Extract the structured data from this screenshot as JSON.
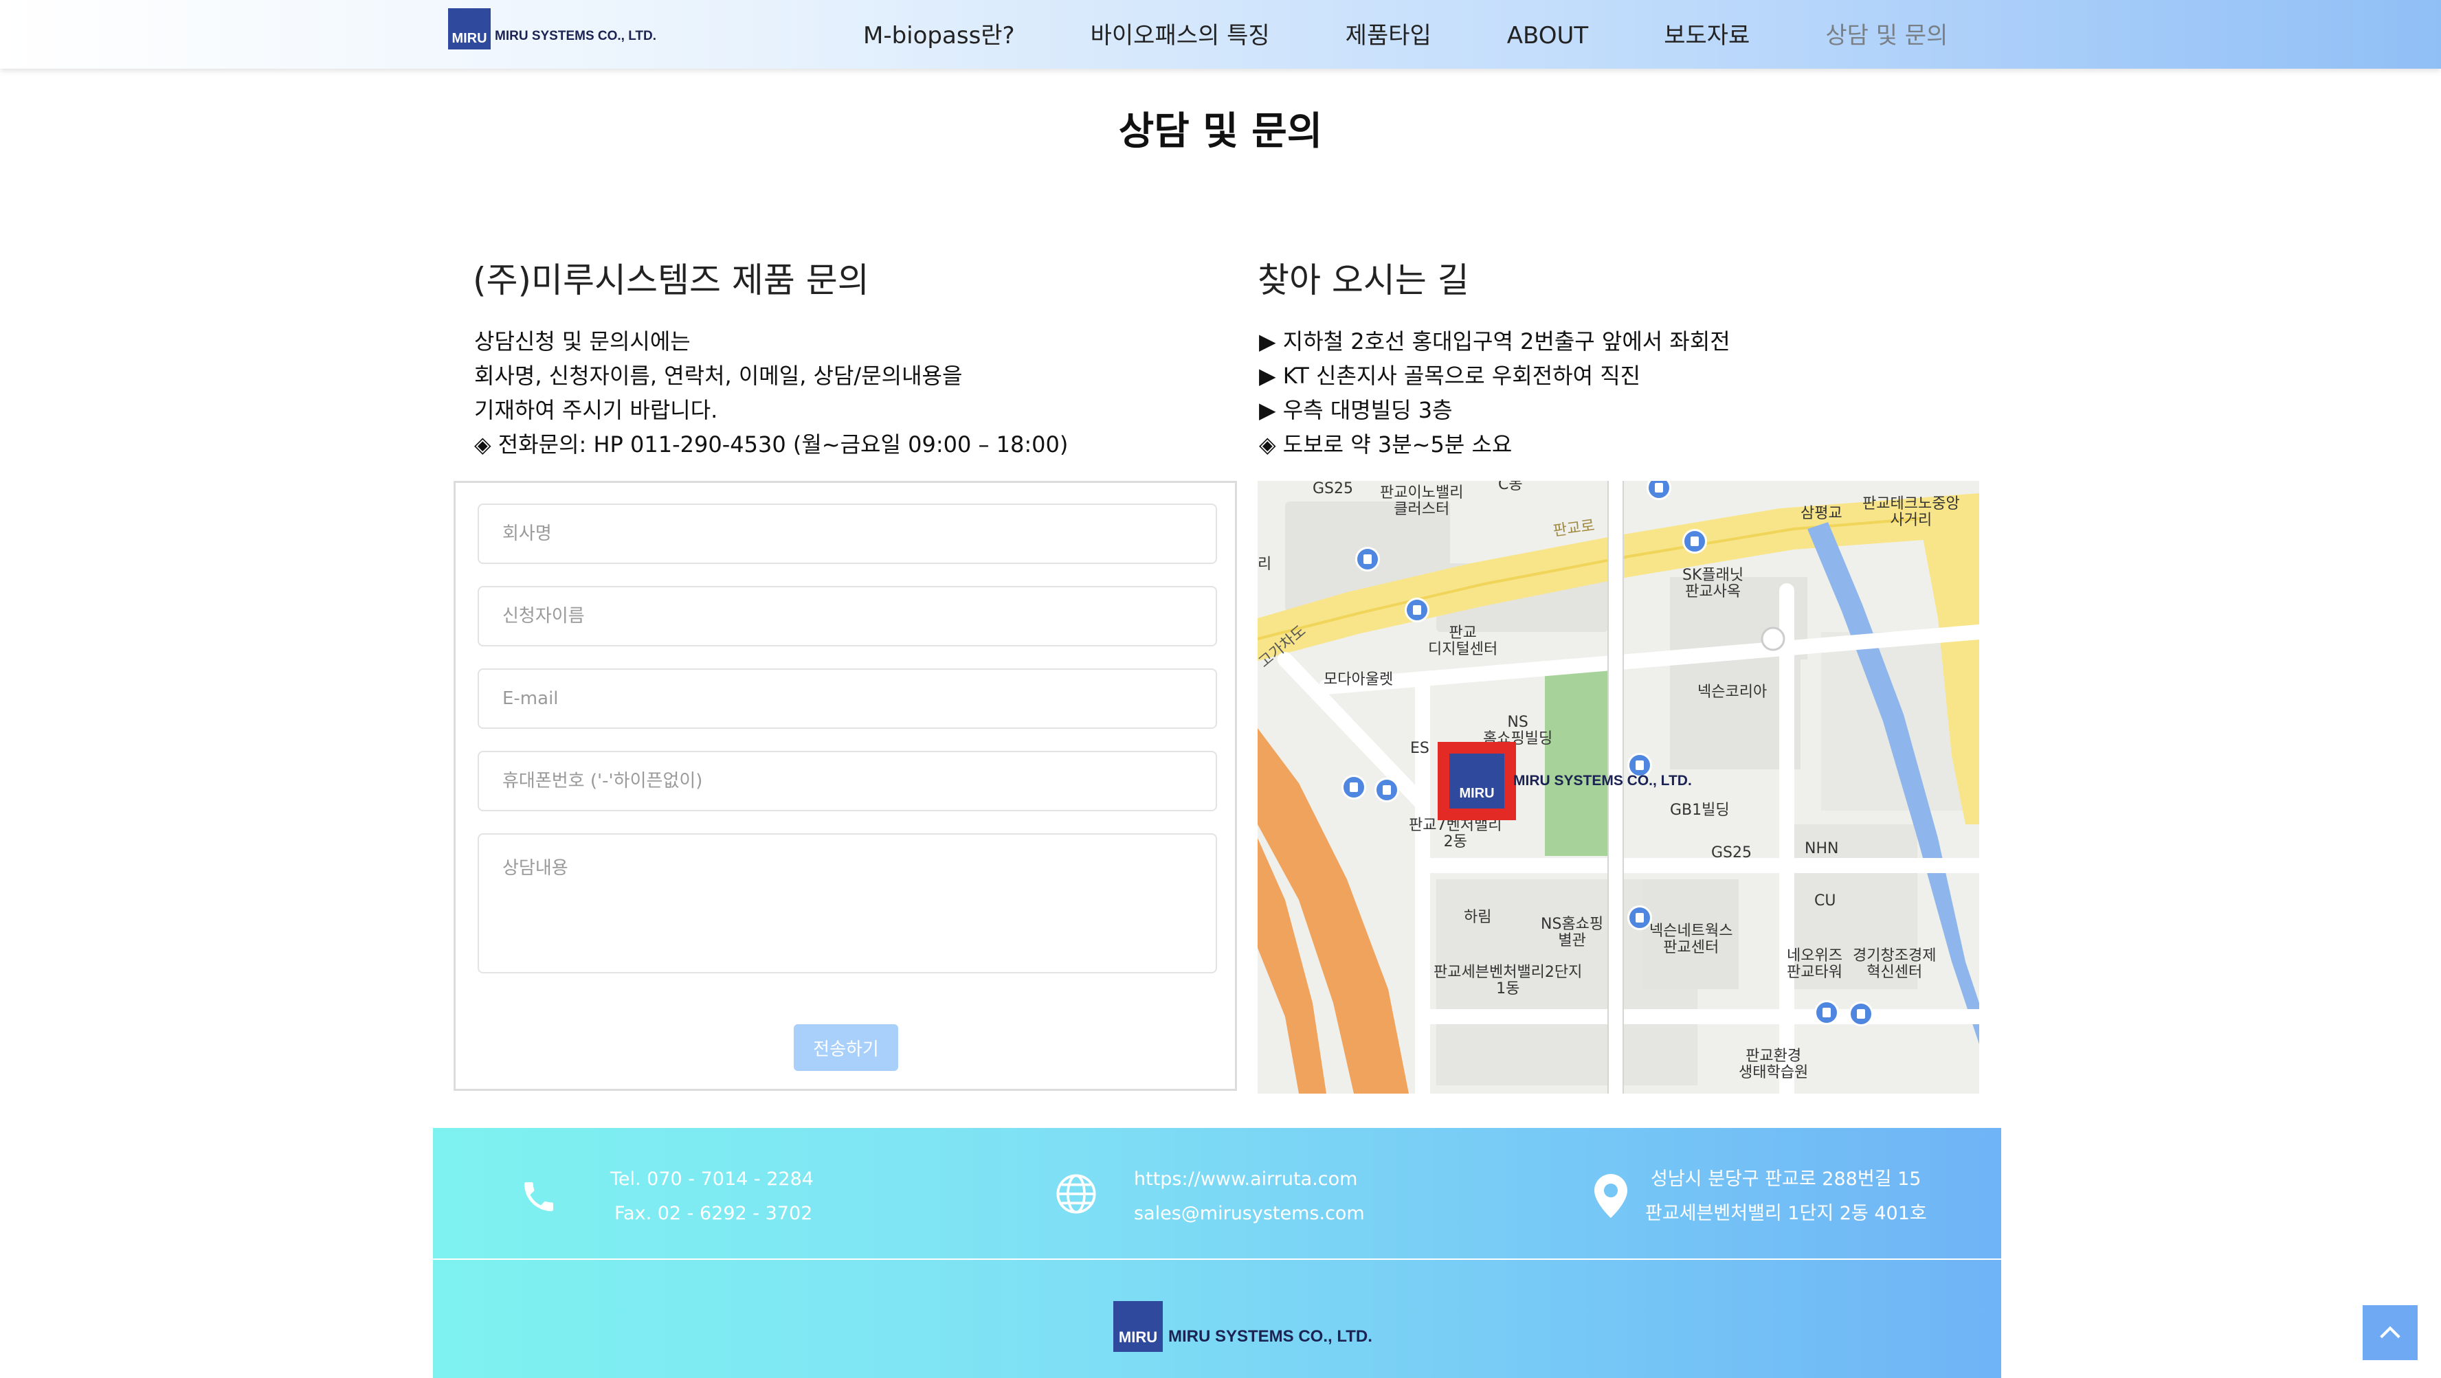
{
  "header": {
    "logo_mark": "MIRU",
    "logo_text": "MIRU SYSTEMS CO., LTD.",
    "nav": [
      {
        "label": "M-biopass란?"
      },
      {
        "label": "바이오패스의 특징"
      },
      {
        "label": "제품타입"
      },
      {
        "label": "ABOUT"
      },
      {
        "label": "보도자료"
      },
      {
        "label": "상담 및 문의",
        "active": true
      }
    ]
  },
  "page_title": "상담 및 문의",
  "inquiry": {
    "title": "(주)미루시스템즈 제품 문의",
    "lines": [
      "상담신청 및 문의시에는",
      "회사명, 신청자이름, 연락처, 이메일, 상담/문의내용을",
      "기재하여 주시기 바랍니다.",
      "◈ 전화문의: HP 011-290-4530 (월~금요일 09:00 – 18:00)"
    ],
    "form": {
      "company_placeholder": "회사명",
      "name_placeholder": "신청자이름",
      "email_placeholder": "E-mail",
      "phone_placeholder": "휴대폰번호 ('-'하이픈없이)",
      "message_placeholder": "상담내용",
      "submit_label": "전송하기"
    }
  },
  "directions": {
    "title": "찾아 오시는 길",
    "lines": [
      "▶ 지하철 2호선 홍대입구역 2번출구 앞에서 좌회전",
      "▶ KT 신촌지사 골목으로 우회전하여 직진",
      "▶ 우측 대명빌딩 3층",
      "◈ 도보로 약 3분~5분 소요"
    ],
    "map": {
      "marker_mark": "MIRU",
      "marker_text": "MIRU SYSTEMS CO., LTD.",
      "labels": [
        "GS25",
        "판교이노밸리\n클러스터",
        "C동",
        "판교로",
        "삼평교",
        "판교테크노중앙\n사거리",
        "SK플래닛\n판교사옥",
        "판교\n디지털센터",
        "모다아울렛",
        "넥슨코리아",
        "NS\n홈쇼핑빌딩",
        "ES",
        "GB1빌딩",
        "GS25",
        "NHN",
        "CU",
        "판교7벤처밸리\n2동",
        "하림",
        "NS홈쇼핑\n별관",
        "넥슨네트웍스\n판교센터",
        "네오위즈\n판교타워",
        "경기창조경제\n혁신센터",
        "판교세븐벤처밸리2단지\n1동",
        "판교환경\n생태학습원",
        "리",
        "고가차도"
      ]
    }
  },
  "footer": {
    "tel": "Tel. 070 - 7014 - 2284",
    "fax": "Fax. 02 - 6292 - 3702",
    "website": "https://www.airruta.com",
    "email": "sales@mirusystems.com",
    "address1": "성남시 분당구 판교로 288번길 15",
    "address2": "판교세븐벤처밸리 1단지 2동 401호",
    "logo_mark": "MIRU",
    "logo_text": "MIRU SYSTEMS CO., LTD."
  },
  "icons": {
    "phone": "phone-icon",
    "globe": "globe-icon",
    "location": "location-pin-icon",
    "scroll_top": "chevron-up-icon"
  }
}
